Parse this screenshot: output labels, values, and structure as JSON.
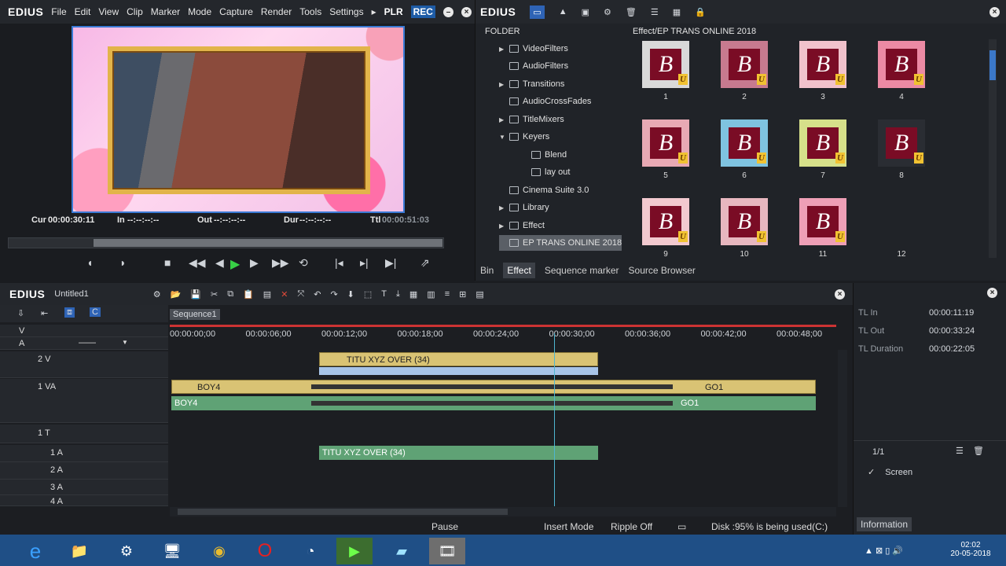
{
  "app": {
    "logo": "EDIUS"
  },
  "top_menu": [
    "File",
    "Edit",
    "View",
    "Clip",
    "Marker",
    "Mode",
    "Capture",
    "Render",
    "Tools",
    "Settings"
  ],
  "top_right": {
    "plr": "PLR",
    "rec": "REC"
  },
  "player": {
    "cur_label": "Cur",
    "cur": "00:00:30:11",
    "in_label": "In",
    "in": "--:--:--:--",
    "out_label": "Out",
    "out": "--:--:--:--",
    "dur_label": "Dur",
    "dur": "--:--:--:--",
    "ttl_label": "Ttl",
    "ttl": "00:00:51:03"
  },
  "effects": {
    "logo": "EDIUS",
    "folder_header": "FOLDER",
    "path": "Effect/EP TRANS ONLINE 2018",
    "tree": [
      {
        "label": "VideoFilters",
        "expand": "▶"
      },
      {
        "label": "AudioFilters",
        "expand": ""
      },
      {
        "label": "Transitions",
        "expand": "▶"
      },
      {
        "label": "AudioCrossFades",
        "expand": ""
      },
      {
        "label": "TitleMixers",
        "expand": "▶"
      },
      {
        "label": "Keyers",
        "expand": "▼"
      },
      {
        "label": "Blend",
        "expand": ""
      },
      {
        "label": "lay out",
        "expand": ""
      },
      {
        "label": "Cinema Suite 3.0",
        "expand": ""
      },
      {
        "label": "Library",
        "expand": "▶"
      },
      {
        "label": "Effect",
        "expand": "▶"
      },
      {
        "label": "EP TRANS ONLINE 2018",
        "expand": ""
      }
    ],
    "thumbs": [
      {
        "letter": "B",
        "badge": "U",
        "label": "1",
        "bg": "#d9d9d9"
      },
      {
        "letter": "B",
        "badge": "U",
        "label": "2",
        "bg": "#c77a8f"
      },
      {
        "letter": "B",
        "badge": "U",
        "label": "3",
        "bg": "#f1c2cc"
      },
      {
        "letter": "B",
        "badge": "U",
        "label": "4",
        "bg": "#ec8aa4"
      },
      {
        "letter": "B",
        "badge": "U",
        "label": "5",
        "bg": "#e8a9b4"
      },
      {
        "letter": "B",
        "badge": "U",
        "label": "6",
        "bg": "#7fc3e0"
      },
      {
        "letter": "B",
        "badge": "U",
        "label": "7",
        "bg": "#d6e08a"
      },
      {
        "letter": "B",
        "badge": "U",
        "label": "8",
        "bg": "#2a2d33"
      },
      {
        "letter": "B",
        "badge": "U",
        "label": "9",
        "bg": "#f2c9cf"
      },
      {
        "letter": "B",
        "badge": "U",
        "label": "10",
        "bg": "#e7b7bf"
      },
      {
        "letter": "B",
        "badge": "U",
        "label": "11",
        "bg": "#ee9fb6"
      },
      {
        "letter": "",
        "badge": "",
        "label": "12",
        "bg": "transparent"
      }
    ],
    "tabs": [
      "Bin",
      "Effect",
      "Sequence marker",
      "Source Browser"
    ]
  },
  "timeline": {
    "logo": "EDIUS",
    "project": "Untitled1",
    "sequence_tab": "Sequence1",
    "ruler": [
      "00:00:00;00",
      "00:00:06;00",
      "00:00:12;00",
      "00:00:18;00",
      "00:00:24;00",
      "00:00:30;00",
      "00:00:36;00",
      "00:00:42;00",
      "00:00:48;00"
    ],
    "v_label": "V",
    "a_label": "A",
    "dash": "——",
    "tracks": {
      "v2": "2 V",
      "va1": "1 VA",
      "t1": "1 T",
      "a1": "1 A",
      "a2": "2 A",
      "a3": "3 A",
      "a4": "4 A"
    },
    "clips": {
      "title_v": "TITU XYZ OVER (34)",
      "boy4_v": "BOY4",
      "go1_v": "GO1",
      "boy4_a": "BOY4",
      "go1_a": "GO1",
      "title_a": "TITU XYZ OVER (34)"
    }
  },
  "info": {
    "rows": [
      {
        "label": "TL In",
        "value": "00:00:11:19"
      },
      {
        "label": "TL Out",
        "value": "00:00:33:24"
      },
      {
        "label": "TL Duration",
        "value": "00:00:22:05"
      }
    ],
    "page": "1/1",
    "screen": "Screen",
    "tab": "Information"
  },
  "status": {
    "state": "Pause",
    "mode": "Insert Mode",
    "ripple": "Ripple Off",
    "disk": "Disk :95% is being used(C:)"
  },
  "taskbar": {
    "time": "02:02",
    "date": "20-05-2018"
  }
}
